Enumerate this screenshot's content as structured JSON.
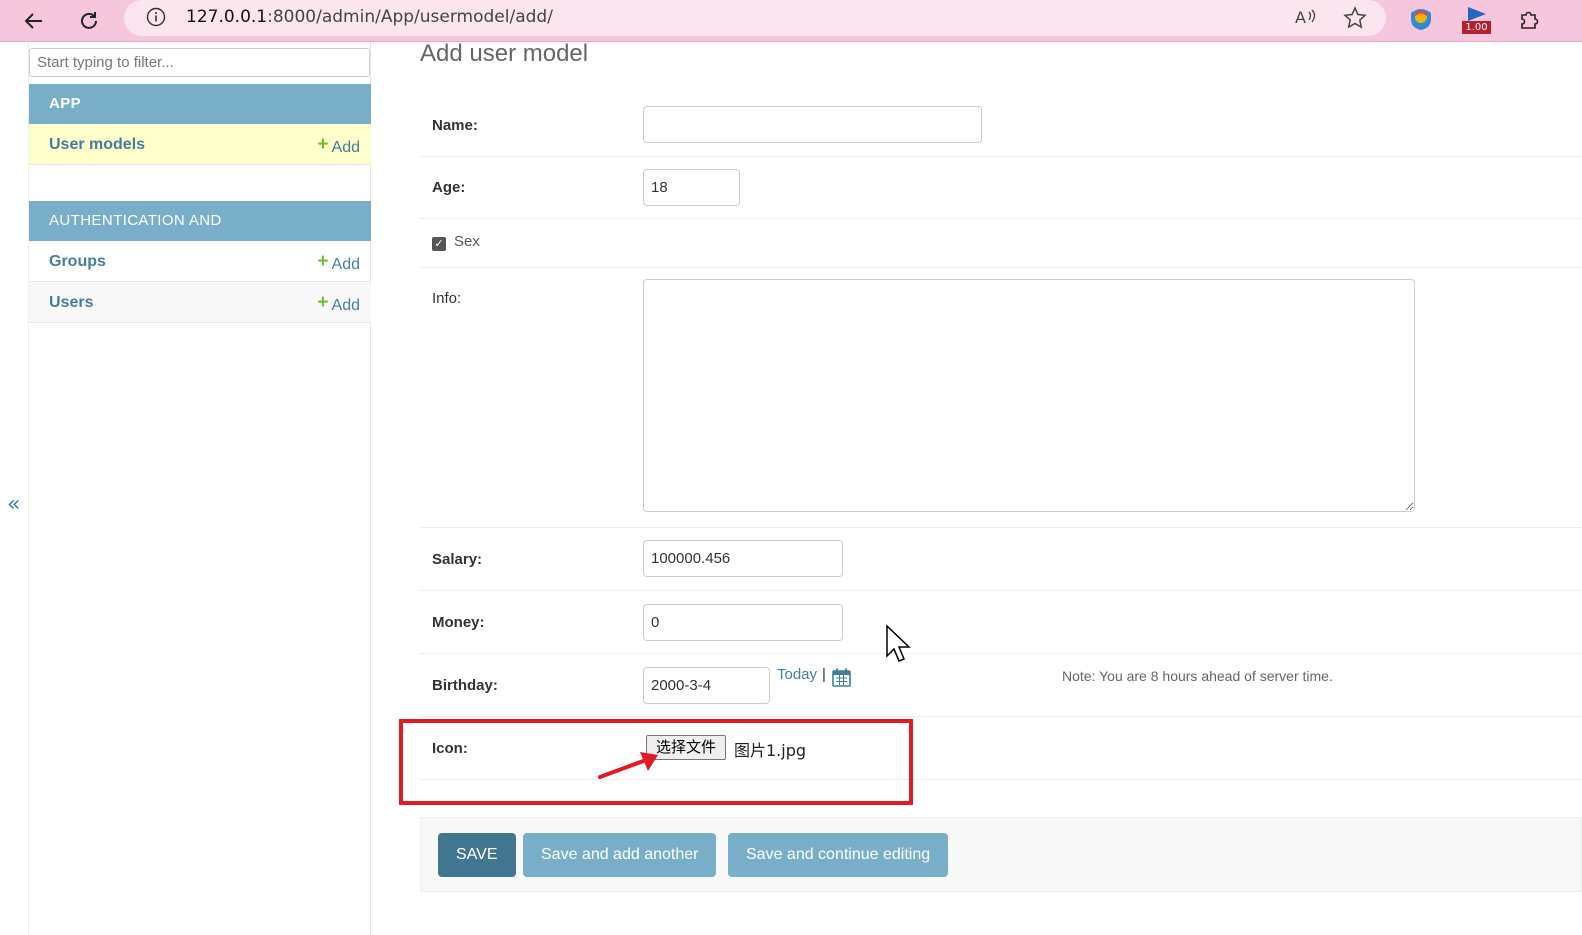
{
  "browser": {
    "url_host": "127.0.0.1",
    "url_path": ":8000/admin/App/usermodel/add/",
    "extension_badge": "1.00"
  },
  "sidebar": {
    "filter_placeholder": "Start typing to filter...",
    "modules": [
      {
        "caption": "APP",
        "models": [
          {
            "name": "User models",
            "add_label": "Add"
          }
        ]
      },
      {
        "caption": "AUTHENTICATION AND AUTHORIZATION",
        "models": [
          {
            "name": "Groups",
            "add_label": "Add"
          },
          {
            "name": "Users",
            "add_label": "Add"
          }
        ]
      }
    ],
    "collapse_glyph": "«"
  },
  "form": {
    "title": "Add user model",
    "name": {
      "label": "Name:",
      "value": ""
    },
    "age": {
      "label": "Age:",
      "value": "18"
    },
    "sex": {
      "label": "Sex",
      "checked": true
    },
    "info": {
      "label": "Info:",
      "value": ""
    },
    "salary": {
      "label": "Salary:",
      "value": "100000.456"
    },
    "money": {
      "label": "Money:",
      "value": "0"
    },
    "birthday": {
      "label": "Birthday:",
      "value": "2000-3-4",
      "today_label": "Today",
      "separator": "|",
      "note": "Note: You are 8 hours ahead of server time."
    },
    "icon": {
      "label": "Icon:",
      "button_label": "选择文件",
      "file_name": "图片1.jpg"
    }
  },
  "submit": {
    "save": "SAVE",
    "save_add_another": "Save and add another",
    "save_continue": "Save and continue editing"
  },
  "colors": {
    "module_caption": "#79aec8",
    "link": "#447e9b",
    "primary_button": "#417690",
    "highlight": "#e01b24"
  }
}
